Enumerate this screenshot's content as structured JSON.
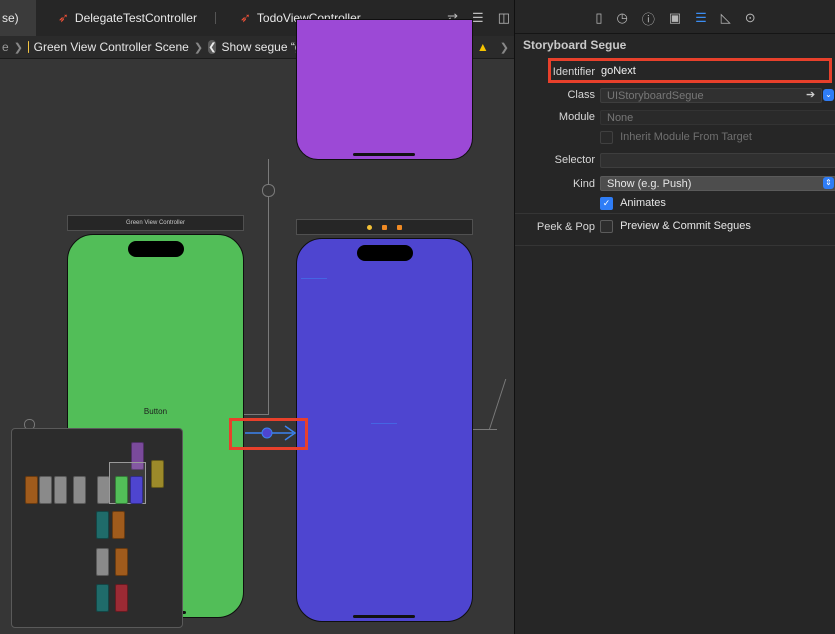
{
  "tabs": [
    {
      "label": "se)",
      "active": true
    },
    {
      "label": "DelegateTestController",
      "active": false
    },
    {
      "label": "TodoViewController",
      "active": false
    }
  ],
  "jumpbar": {
    "partial": "e",
    "scene": "Green View Controller Scene",
    "segue": "Show segue “goNext” to “View Controller”"
  },
  "canvas": {
    "green_scene_title": "Green View Controller",
    "button_label": "Button",
    "colors": {
      "green": "#52be58",
      "blue": "#4e45d0",
      "purple": "#9c49d6"
    }
  },
  "inspector": {
    "title": "Storyboard Segue",
    "identifier_label": "Identifier",
    "identifier_value": "goNext",
    "class_label": "Class",
    "class_placeholder": "UIStoryboardSegue",
    "module_label": "Module",
    "module_placeholder": "None",
    "inherit_label": "Inherit Module From Target",
    "selector_label": "Selector",
    "selector_value": "",
    "kind_label": "Kind",
    "kind_value": "Show (e.g. Push)",
    "animates_label": "Animates",
    "peek_pop_label": "Peek & Pop",
    "preview_label": "Preview & Commit Segues"
  },
  "highlight_color": "#e8402b",
  "accent_color": "#2f7df6"
}
